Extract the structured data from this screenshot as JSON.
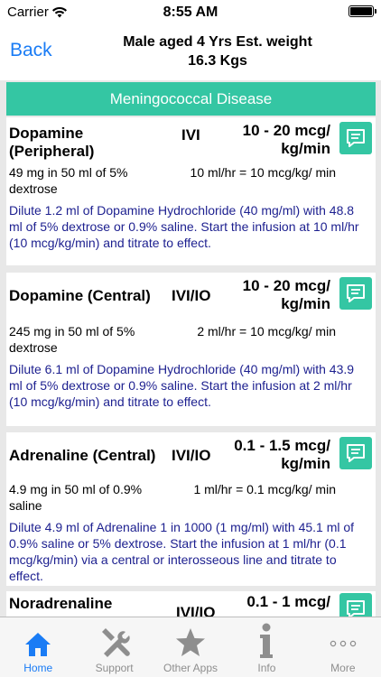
{
  "status_bar": {
    "carrier": "Carrier",
    "time": "8:55 AM"
  },
  "nav": {
    "back_label": "Back",
    "title_line1": "Male aged 4 Yrs  Est. weight",
    "title_line2": "16.3 Kgs"
  },
  "section": {
    "title": "Meningococcal Disease"
  },
  "drugs": [
    {
      "name": "Dopamine (Peripheral)",
      "route": "IVI",
      "dose": "10 - 20 mcg/ kg/min",
      "concentration": "49 mg in 50 ml of 5% dextrose",
      "rate": "10 ml/hr = 10 mcg/kg/ min",
      "instructions": "Dilute 1.2 ml of Dopamine Hydrochloride (40 mg/ml) with 48.8 ml of 5% dextrose or 0.9% saline. Start the infusion at 10 ml/hr (10 mcg/kg/min) and titrate to effect."
    },
    {
      "name": "Dopamine (Central)",
      "route": "IVI/IO",
      "dose": "10 - 20 mcg/ kg/min",
      "concentration": "245 mg in 50 ml of 5% dextrose",
      "rate": "2 ml/hr = 10 mcg/kg/ min",
      "instructions": "Dilute 6.1 ml of Dopamine Hydrochloride (40 mg/ml) with 43.9 ml of 5% dextrose or 0.9% saline. Start the infusion at 2 ml/hr (10 mcg/kg/min) and titrate to effect."
    },
    {
      "name": "Adrenaline (Central)",
      "route": "IVI/IO",
      "dose": "0.1 - 1.5 mcg/ kg/min",
      "concentration": "4.9 mg in 50 ml of 0.9% saline",
      "rate": "1 ml/hr = 0.1 mcg/kg/ min",
      "instructions": "Dilute 4.9 ml of Adrenaline 1 in 1000 (1 mg/ml) with 45.1 ml of 0.9% saline or 5% dextrose. Start the infusion at 1 ml/hr (0.1 mcg/kg/min) via a central or interosseous line and titrate to effect."
    },
    {
      "name": "Noradrenaline",
      "route": "IVI/IO",
      "dose": "0.1 - 1 mcg/",
      "concentration": "",
      "rate": "",
      "instructions": ""
    }
  ],
  "tabs": [
    {
      "label": "Home",
      "icon": "home-icon",
      "active": true
    },
    {
      "label": "Support",
      "icon": "tools-icon",
      "active": false
    },
    {
      "label": "Other Apps",
      "icon": "star-icon",
      "active": false
    },
    {
      "label": "Info",
      "icon": "info-icon",
      "active": false
    },
    {
      "label": "More",
      "icon": "more-icon",
      "active": false
    }
  ],
  "colors": {
    "accent": "#34c6a3",
    "link": "#1a7cf5",
    "instruction_text": "#1c1f8f"
  }
}
